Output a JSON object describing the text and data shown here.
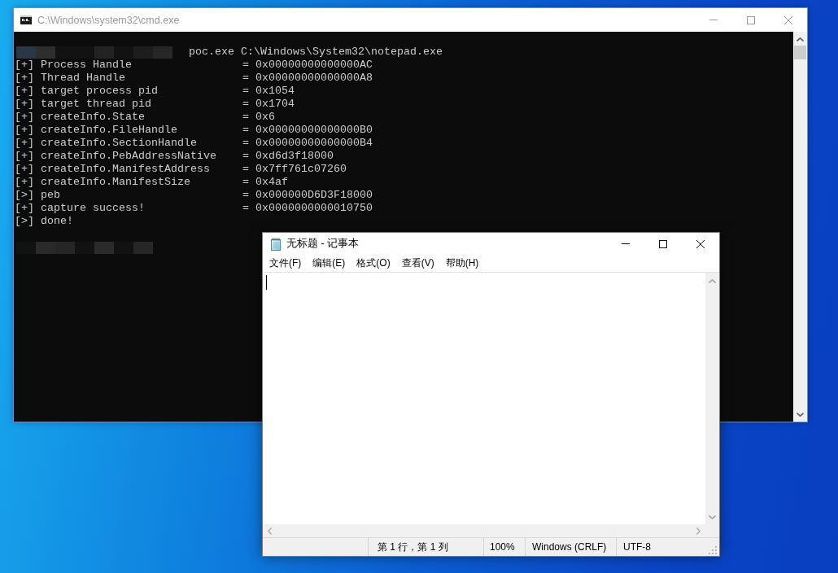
{
  "cmd_window": {
    "title": "C:\\Windows\\system32\\cmd.exe",
    "active": false,
    "command": "poc.exe C:\\Windows\\System32\\notepad.exe",
    "output": [
      {
        "marker": "[+]",
        "label": "Process Handle",
        "operator": "=",
        "value": "0x00000000000000AC"
      },
      {
        "marker": "[+]",
        "label": "Thread Handle",
        "operator": "=",
        "value": "0x00000000000000A8"
      },
      {
        "marker": "[+]",
        "label": "target process pid",
        "operator": "=",
        "value": "0x1054"
      },
      {
        "marker": "[+]",
        "label": "target thread pid",
        "operator": "=",
        "value": "0x1704"
      },
      {
        "marker": "[+]",
        "label": "createInfo.State",
        "operator": "=",
        "value": "0x6"
      },
      {
        "marker": "[+]",
        "label": "createInfo.FileHandle",
        "operator": "=",
        "value": "0x00000000000000B0"
      },
      {
        "marker": "[+]",
        "label": "createInfo.SectionHandle",
        "operator": "=",
        "value": "0x00000000000000B4"
      },
      {
        "marker": "[+]",
        "label": "createInfo.PebAddressNative",
        "operator": "=",
        "value": "0xd6d3f18000"
      },
      {
        "marker": "[+]",
        "label": "createInfo.ManifestAddress",
        "operator": "=",
        "value": "0x7ff761c07260"
      },
      {
        "marker": "[+]",
        "label": "createInfo.ManifestSize",
        "operator": "=",
        "value": "0x4af"
      },
      {
        "marker": "[>]",
        "label": "peb",
        "operator": "=",
        "value": "0x000000D6D3F18000"
      },
      {
        "marker": "[+]",
        "label": "capture success!",
        "operator": "=",
        "value": "0x0000000000010750"
      },
      {
        "marker": "[>]",
        "label": "done!"
      }
    ]
  },
  "notepad_window": {
    "title": "无标题 - 记事本",
    "active": true,
    "menu": [
      "文件(F)",
      "编辑(E)",
      "格式(O)",
      "查看(V)",
      "帮助(H)"
    ],
    "status_bar": [
      "第 1 行，第 1 列",
      "100%",
      "Windows (CRLF)",
      "UTF-8"
    ]
  }
}
